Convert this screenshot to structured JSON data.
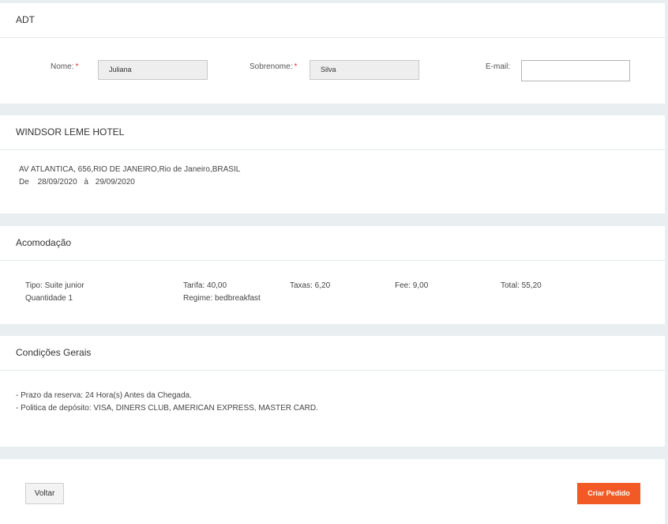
{
  "passenger": {
    "title": "ADT",
    "first_name_label": "Nome:",
    "first_name_value": "Juliana",
    "last_name_label": "Sobrenome:",
    "last_name_value": "Silva",
    "email_label": "E-mail:",
    "email_value": "",
    "required_mark": "*"
  },
  "hotel": {
    "name": "WINDSOR LEME HOTEL",
    "address": "AV ATLANTICA, 656,RIO DE JANEIRO,Rio de Janeiro,BRASIL",
    "from_label": "De",
    "check_in": "28/09/2020",
    "to_label": "à",
    "check_out": "29/09/2020"
  },
  "accommodation": {
    "title": "Acomodação",
    "type": "Tipo: Suite junior",
    "quantity": "Quantidade 1",
    "rate": "Tarifa: 40,00",
    "regime": "Regime: bedbreakfast",
    "taxes": "Taxas: 6,20",
    "fee": "Fee: 9,00",
    "total": "Total: 55,20"
  },
  "conditions": {
    "title": "Condições Gerais",
    "lines": [
      "- Prazo da reserva: 24 Hora(s) Antes da Chegada.",
      "- Politica de depósito: VISA, DINERS CLUB, AMERICAN EXPRESS, MASTER CARD."
    ]
  },
  "actions": {
    "back_label": "Voltar",
    "create_label": "Criar Pedido",
    "create_color": "#f15a24"
  }
}
